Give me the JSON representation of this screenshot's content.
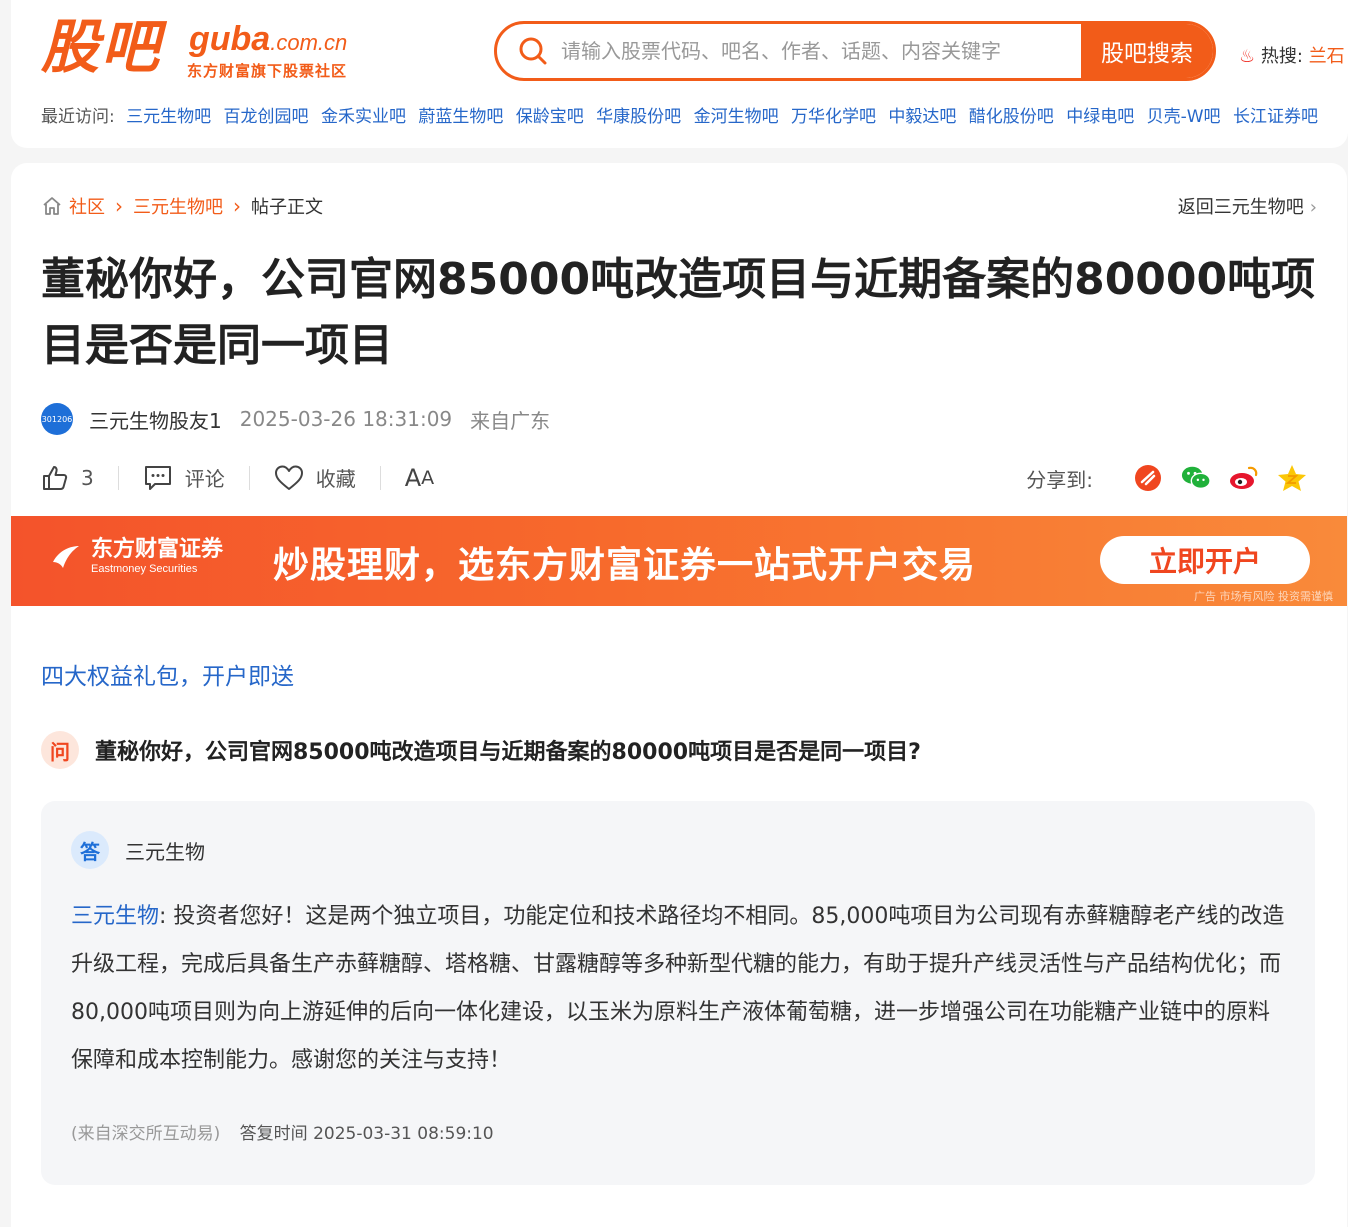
{
  "header": {
    "logo_cn": "股吧",
    "logo_en_main": "guba",
    "logo_en_domain": ".com.cn",
    "logo_sub": "东方财富旗下股票社区",
    "search_placeholder": "请输入股票代码、吧名、作者、话题、内容关键字",
    "search_button": "股吧搜索",
    "hot_label": "热搜:",
    "hot_link": "兰石",
    "recent_label": "最近访问:",
    "recent_items": [
      "三元生物吧",
      "百龙创园吧",
      "金禾实业吧",
      "蔚蓝生物吧",
      "保龄宝吧",
      "华康股份吧",
      "金河生物吧",
      "万华化学吧",
      "中毅达吧",
      "醋化股份吧",
      "中绿电吧",
      "贝壳-W吧",
      "长江证券吧"
    ]
  },
  "breadcrumb": {
    "home": "社区",
    "bar": "三元生物吧",
    "current": "帖子正文",
    "back": "返回三元生物吧"
  },
  "post": {
    "title": "董秘你好，公司官网85000吨改造项目与近期备案的80000吨项目是否是同一项目",
    "avatar_text": "301206",
    "author": "三元生物股友1",
    "time": "2025-03-26 18:31:09",
    "location": "来自广东",
    "likes": "3",
    "comment_label": "评论",
    "favorite_label": "收藏",
    "font_label_big": "A",
    "font_label_small": "A",
    "share_label": "分享到:"
  },
  "banner": {
    "brand_cn": "东方财富证券",
    "brand_en": "Eastmoney Securities",
    "slogan": "炒股理财，选东方财富证券一站式开户交易",
    "button": "立即开户",
    "note": "广告 市场有风险 投资需谨慎"
  },
  "promo": "四大权益礼包，开户即送",
  "qa": {
    "q_badge": "问",
    "question": "董秘你好，公司官网85000吨改造项目与近期备案的80000吨项目是否是同一项目?",
    "a_badge": "答",
    "answerer": "三元生物",
    "answer_who": "三元生物",
    "answer_text": ": 投资者您好！这是两个独立项目，功能定位和技术路径均不相同。85,000吨项目为公司现有赤藓糖醇老产线的改造升级工程，完成后具备生产赤藓糖醇、塔格糖、甘露糖醇等多种新型代糖的能力，有助于提升产线灵活性与产品结构优化；而80,000吨项目则为向上游延伸的后向一体化建设，以玉米为原料生产液体葡萄糖，进一步增强公司在功能糖产业链中的原料保障和成本控制能力。感谢您的关注与支持！",
    "source": "(来自深交所互动易)",
    "reply_time": "答复时间 2025-03-31 08:59:10"
  },
  "colors": {
    "brand_orange": "#f25c19",
    "link_blue": "#2667c9"
  }
}
